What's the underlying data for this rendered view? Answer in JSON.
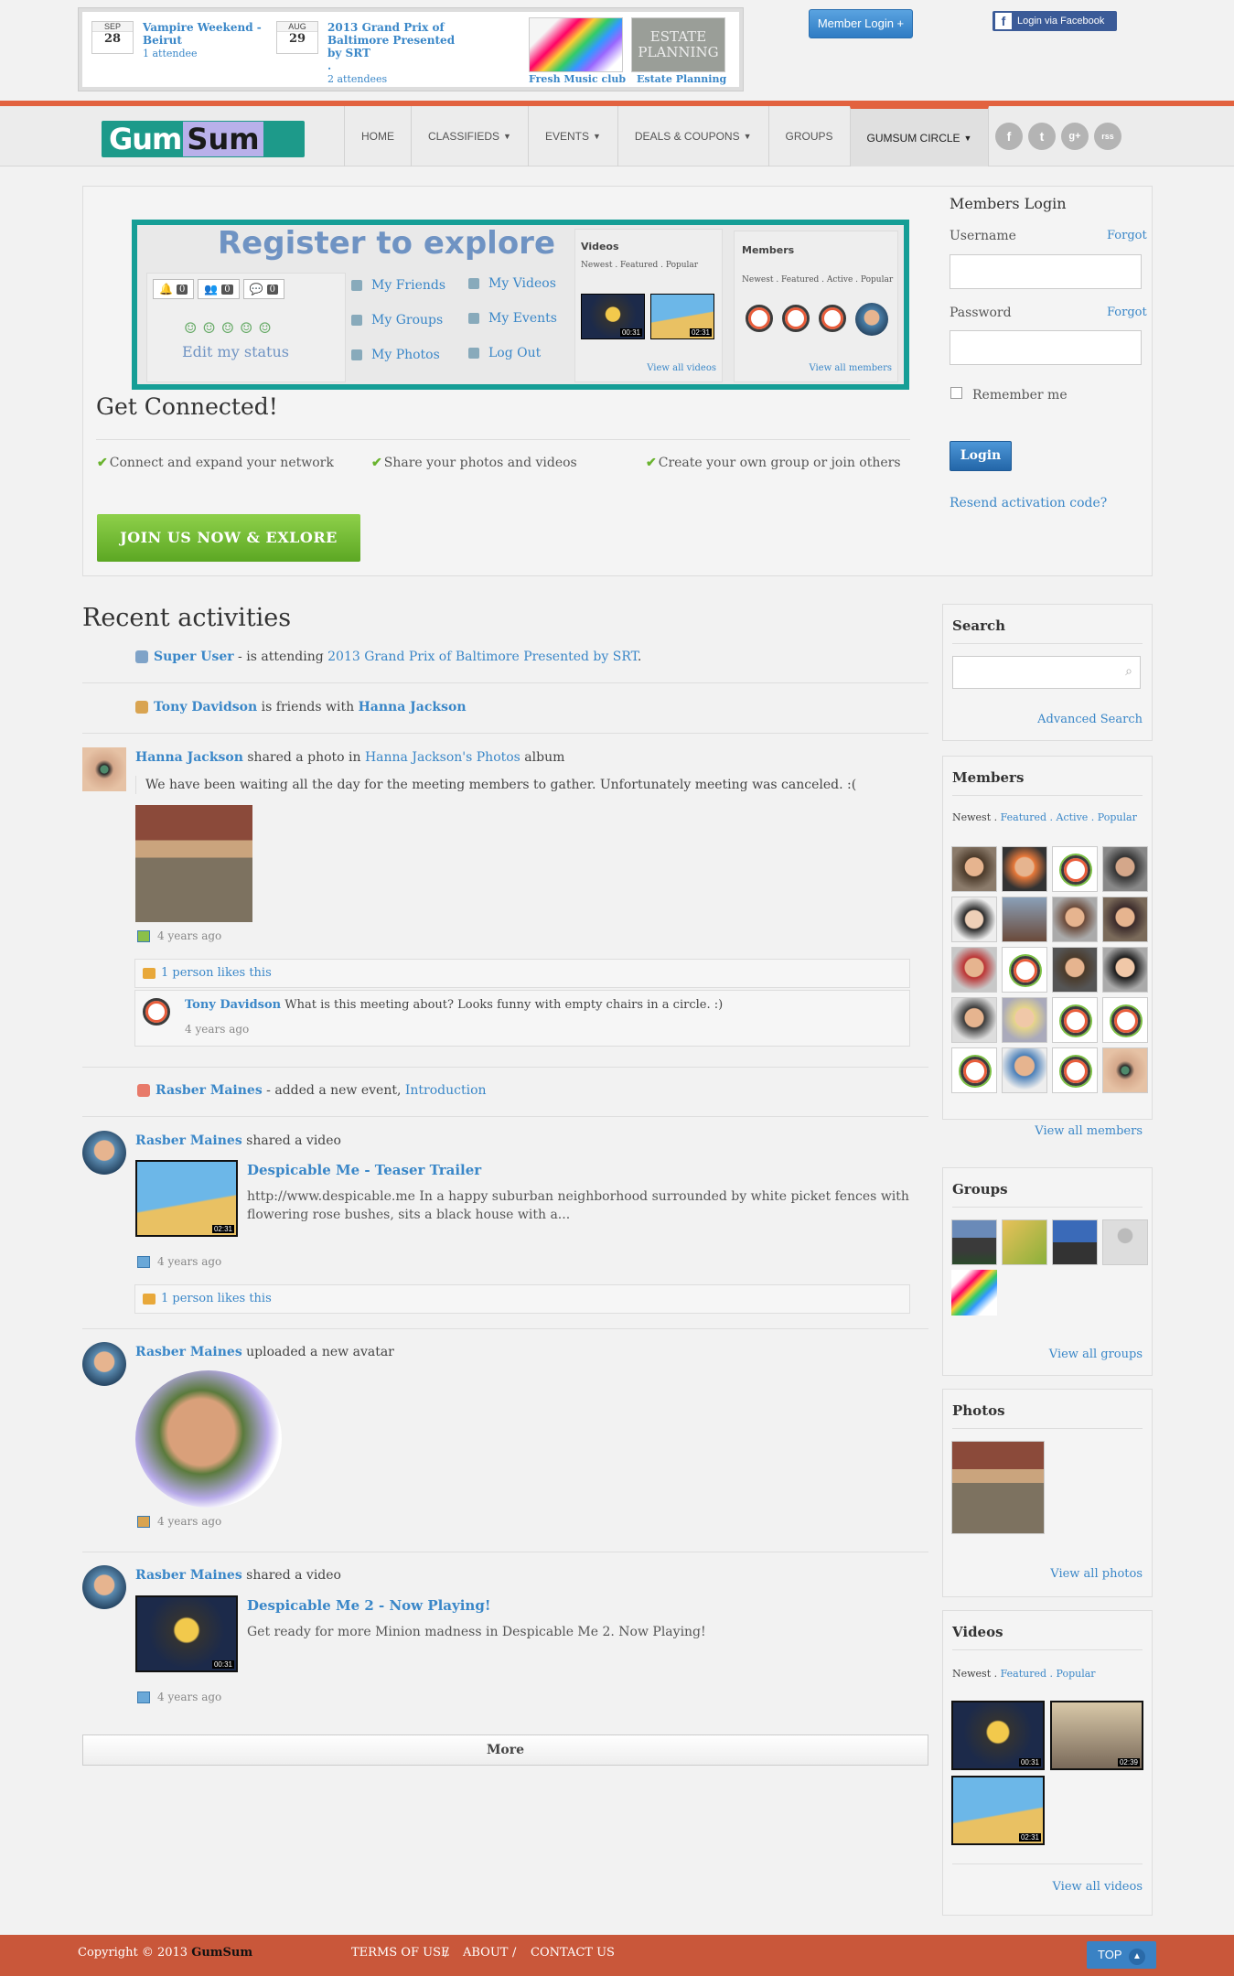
{
  "promo": {
    "events": [
      {
        "month": "SEP",
        "day": "28",
        "title": "Vampire Weekend - Beirut",
        "attendees": "1 attendee"
      },
      {
        "month": "AUG",
        "day": "29",
        "title": "2013 Grand Prix of Baltimore Presented by SRT",
        "attendees": "2 attendees"
      }
    ],
    "clubs": [
      {
        "caption": "Fresh Music club"
      },
      {
        "caption": "Estate Planning",
        "image_text": "ESTATE PLANNING"
      }
    ]
  },
  "header": {
    "member_login": "Member Login +",
    "facebook_login": "Login via Facebook",
    "logo": {
      "part1": "Gum",
      "part2": "Sum"
    },
    "nav": [
      "HOME",
      "CLASSIFIEDS",
      "EVENTS",
      "DEALS & COUPONS",
      "GROUPS",
      "GUMSUM CIRCLE"
    ],
    "social": [
      "f",
      "t",
      "g+",
      "rss"
    ]
  },
  "hero": {
    "register_title": "Register to explore",
    "badges": [
      "0",
      "0",
      "0"
    ],
    "edit_status": "Edit my status",
    "links_left": [
      "My Friends",
      "My Groups",
      "My Photos"
    ],
    "links_right": [
      "My Videos",
      "My Events",
      "Log Out"
    ],
    "videos_head": "Videos",
    "videos_tabs": "Newest . Featured . Popular",
    "video_durations": [
      "00:31",
      "02:31"
    ],
    "view_all_videos": "View all videos",
    "members_head": "Members",
    "members_tabs": "Newest . Featured . Active . Popular",
    "view_all_members": "View all members",
    "get_connected": "Get Connected!",
    "features": [
      "Connect and expand your network",
      "Share your photos and videos",
      "Create your own group or join others"
    ],
    "join_button": "JOIN US NOW & EXLORE"
  },
  "login": {
    "title": "Members Login",
    "username_label": "Username",
    "password_label": "Password",
    "forgot": "Forgot",
    "remember": "Remember me",
    "button": "Login",
    "resend": "Resend activation code?"
  },
  "activities": {
    "title": "Recent activities",
    "items": [
      {
        "actor": "Super User",
        "text": " - is attending ",
        "target": "2013 Grand Prix of Baltimore Presented by SRT",
        "end": "."
      },
      {
        "actor": "Tony Davidson",
        "text": " is friends with ",
        "target": "Hanna Jackson"
      },
      {
        "actor": "Hanna Jackson",
        "text": " shared a photo in ",
        "target": "Hanna Jackson's Photos",
        "end": " album",
        "quote": "We have been waiting all the day for the meeting members to gather. Unfortunately meeting was canceled. :(",
        "time": "4 years ago",
        "likes": "1 person likes this",
        "comment_author": "Tony Davidson",
        "comment_text": " What is this meeting about? Looks funny with empty chairs in a circle. :)",
        "comment_time": "4 years ago"
      },
      {
        "actor": "Rasber Maines",
        "text": " - added a new event, ",
        "target": "Introduction"
      },
      {
        "actor": "Rasber Maines",
        "text": " shared a video",
        "video_title": "Despicable Me - Teaser Trailer",
        "video_desc": "http://www.despicable.me In a happy suburban neighborhood surrounded by white picket fences with flowering rose bushes, sits a black house with a...",
        "duration": "02:31",
        "time": "4 years ago",
        "likes": "1 person likes this"
      },
      {
        "actor": "Rasber Maines",
        "text": " uploaded a new avatar",
        "time": "4 years ago"
      },
      {
        "actor": "Rasber Maines",
        "text": " shared a video",
        "video_title": "Despicable Me 2 - Now Playing!",
        "video_desc": "Get ready for more Minion madness in Despicable Me 2. Now Playing!",
        "duration": "00:31",
        "time": "4 years ago"
      }
    ],
    "more": "More"
  },
  "sidebar": {
    "search": {
      "title": "Search",
      "advanced": "Advanced Search"
    },
    "members": {
      "title": "Members",
      "tabs_newest": "Newest . ",
      "tabs_rest": "Featured . Active . Popular",
      "view_all": "View all members"
    },
    "groups": {
      "title": "Groups",
      "view_all": "View all groups"
    },
    "photos": {
      "title": "Photos",
      "view_all": "View all photos"
    },
    "videos": {
      "title": "Videos",
      "tabs_newest": "Newest . ",
      "tabs_rest": "Featured . Popular",
      "durations": [
        "00:31",
        "02:39",
        "02:31"
      ],
      "view_all": "View all videos"
    }
  },
  "footer": {
    "copyright": "Copyright © 2013 ",
    "brand": "GumSum",
    "links": [
      "TERMS OF USE",
      "/",
      "ABOUT",
      "/",
      "CONTACT US"
    ],
    "top": "TOP"
  },
  "colors": {
    "accent": "#e2623f",
    "link": "#3a87c8",
    "teal": "#159e96",
    "green": "#69b32e"
  }
}
